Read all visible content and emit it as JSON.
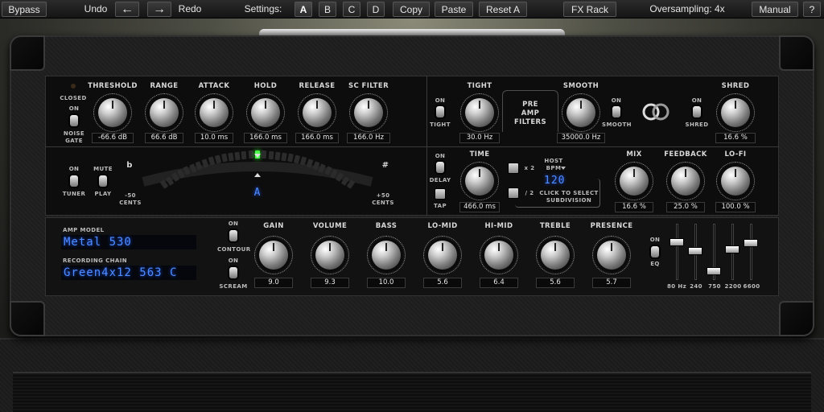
{
  "toolbar": {
    "bypass": "Bypass",
    "undo": "Undo",
    "redo": "Redo",
    "settings_label": "Settings:",
    "presets": [
      "A",
      "B",
      "C",
      "D"
    ],
    "selected_preset": "A",
    "copy": "Copy",
    "paste": "Paste",
    "reset": "Reset A",
    "fx_rack": "FX Rack",
    "oversampling": "Oversampling: 4x",
    "manual": "Manual",
    "help": "?"
  },
  "gate": {
    "closed_label": "CLOSED",
    "on_label": "ON",
    "noise_label": "NOISE",
    "gate_label": "GATE",
    "knobs": [
      {
        "label": "THRESHOLD",
        "value": "-66.6 dB"
      },
      {
        "label": "RANGE",
        "value": "66.6 dB"
      },
      {
        "label": "ATTACK",
        "value": "10.0 ms"
      },
      {
        "label": "HOLD",
        "value": "166.0 ms"
      },
      {
        "label": "RELEASE",
        "value": "166.0 ms"
      },
      {
        "label": "SC FILTER",
        "value": "166.0 Hz"
      }
    ]
  },
  "preamp": {
    "tight_label": "TIGHT",
    "tight_value": "30.0 Hz",
    "tight_on": "ON",
    "tight_sw": "TIGHT",
    "title": [
      "PRE",
      "AMP",
      "FILTERS"
    ],
    "smooth_label": "SMOOTH",
    "smooth_value": "35000.0 Hz",
    "smooth_on": "ON",
    "smooth_sw": "SMOOTH",
    "shred_on": "ON",
    "shred_sw": "SHRED",
    "shred_label": "SHRED",
    "shred_value": "16.6 %"
  },
  "tuner": {
    "on_label": "ON",
    "tuner_label": "TUNER",
    "mute_label": "MUTE",
    "play_label": "PLAY",
    "flat": "b",
    "sharp": "#",
    "left_range": "-50",
    "left_cents": "CENTS",
    "right_range": "+50",
    "right_cents": "CENTS",
    "note": "A"
  },
  "delay": {
    "on_label": "ON",
    "delay_label": "DELAY",
    "tap_label": "TAP",
    "time_label": "TIME",
    "time_value": "466.0 ms",
    "x2": "x 2",
    "div2": "/ 2",
    "host_label": "HOST",
    "bpm_label": "BPM",
    "bpm": "120",
    "click_line1": "CLICK TO SELECT",
    "click_line2": "SUBDIVISION",
    "knobs": [
      {
        "label": "MIX",
        "value": "16.6 %"
      },
      {
        "label": "FEEDBACK",
        "value": "25.0 %"
      },
      {
        "label": "LO-FI",
        "value": "100.0 %"
      }
    ]
  },
  "amp": {
    "model_label": "AMP MODEL",
    "model_value": "Metal 530",
    "chain_label": "RECORDING CHAIN",
    "chain_value": "Green4x12 563 C",
    "contour_on": "ON",
    "contour": "CONTOUR",
    "scream_on": "ON",
    "scream": "SCREAM",
    "knobs": [
      {
        "label": "GAIN",
        "value": "9.0"
      },
      {
        "label": "VOLUME",
        "value": "9.3"
      },
      {
        "label": "BASS",
        "value": "10.0"
      },
      {
        "label": "LO-MID",
        "value": "5.6"
      },
      {
        "label": "HI-MID",
        "value": "6.4"
      },
      {
        "label": "TREBLE",
        "value": "5.6"
      },
      {
        "label": "PRESENCE",
        "value": "5.7"
      }
    ]
  },
  "eq": {
    "on_label": "ON",
    "eq_label": "EQ",
    "bands": [
      "80 Hz",
      "240",
      "750",
      "2200",
      "6600"
    ],
    "levels": [
      0.72,
      0.55,
      0.15,
      0.58,
      0.7
    ]
  }
}
